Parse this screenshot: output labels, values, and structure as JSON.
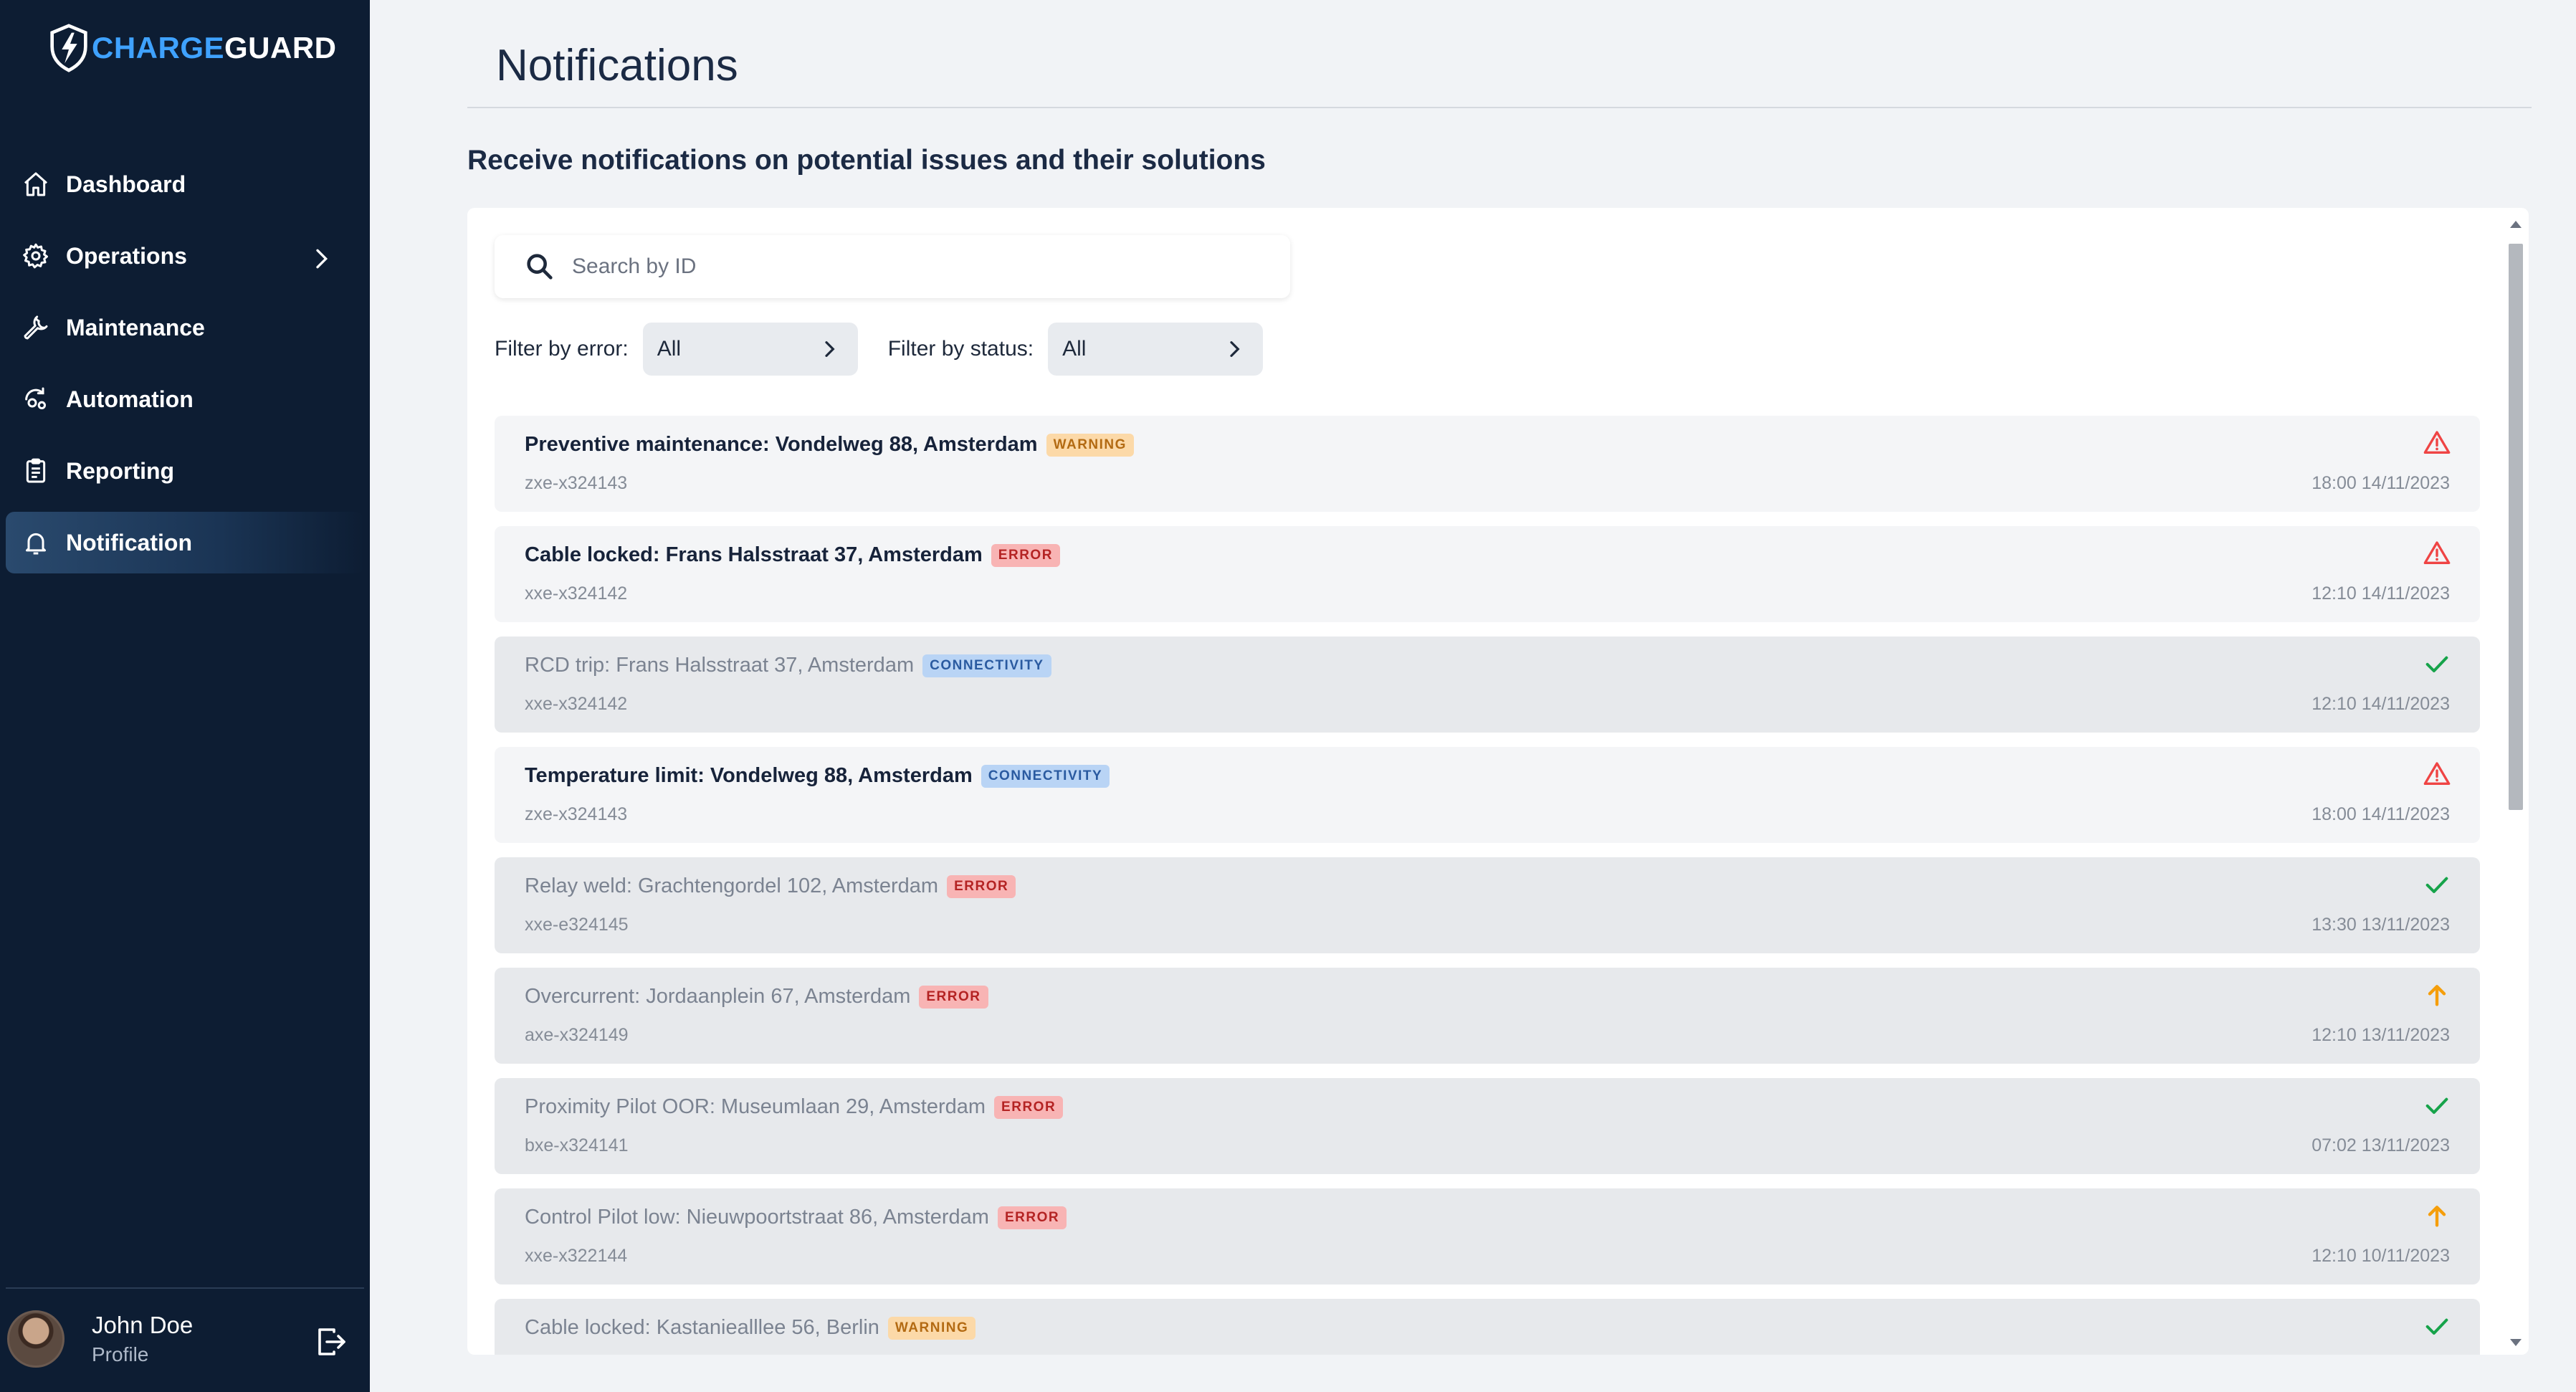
{
  "brand": {
    "part1": "CHARGE",
    "part2": "GUARD",
    "accent": "#3fa2ff"
  },
  "sidebar": {
    "items": [
      {
        "label": "Dashboard",
        "icon": "home-icon",
        "active": false
      },
      {
        "label": "Operations",
        "icon": "gear-icon",
        "active": false,
        "has_submenu": true
      },
      {
        "label": "Maintenance",
        "icon": "wrench-icon",
        "active": false
      },
      {
        "label": "Automation",
        "icon": "automation-icon",
        "active": false
      },
      {
        "label": "Reporting",
        "icon": "clipboard-icon",
        "active": false
      },
      {
        "label": "Notification",
        "icon": "bell-icon",
        "active": true
      }
    ],
    "user": {
      "name": "John Doe",
      "subtitle": "Profile"
    }
  },
  "page": {
    "title": "Notifications",
    "subtitle": "Receive notifications on potential issues and their solutions"
  },
  "search": {
    "placeholder": "Search by ID",
    "value": ""
  },
  "filters": {
    "error_label": "Filter by error:",
    "error_value": "All",
    "status_label": "Filter by status:",
    "status_value": "All"
  },
  "badge_colors": {
    "WARNING": {
      "bg": "#fcd9a8",
      "fg": "#b36a12"
    },
    "ERROR": {
      "bg": "#f8b4b4",
      "fg": "#b42323"
    },
    "CONNECTIVITY": {
      "bg": "#b9d4f5",
      "fg": "#2a5aa0"
    }
  },
  "status_icon_colors": {
    "warning-triangle-icon": "#ef4444",
    "checkmark-icon": "#16a34a",
    "arrow-up-icon": "#f59e0b"
  },
  "notifications": [
    {
      "title": "Preventive maintenance: Vondelweg 88, Amsterdam",
      "badge": "WARNING",
      "id": "zxe-x324143",
      "time": "18:00 14/11/2023",
      "status_icon": "warning-triangle-icon",
      "read": false
    },
    {
      "title": "Cable locked: Frans Halsstraat 37, Amsterdam",
      "badge": "ERROR",
      "id": "xxe-x324142",
      "time": "12:10 14/11/2023",
      "status_icon": "warning-triangle-icon",
      "read": false
    },
    {
      "title": "RCD trip: Frans Halsstraat 37, Amsterdam",
      "badge": "CONNECTIVITY",
      "id": "xxe-x324142",
      "time": "12:10 14/11/2023",
      "status_icon": "checkmark-icon",
      "read": true
    },
    {
      "title": "Temperature limit: Vondelweg 88, Amsterdam",
      "badge": "CONNECTIVITY",
      "id": "zxe-x324143",
      "time": "18:00 14/11/2023",
      "status_icon": "warning-triangle-icon",
      "read": false
    },
    {
      "title": "Relay weld: Grachtengordel 102, Amsterdam",
      "badge": "ERROR",
      "id": "xxe-e324145",
      "time": "13:30 13/11/2023",
      "status_icon": "checkmark-icon",
      "read": true
    },
    {
      "title": "Overcurrent: Jordaanplein 67, Amsterdam",
      "badge": "ERROR",
      "id": "axe-x324149",
      "time": "12:10 13/11/2023",
      "status_icon": "arrow-up-icon",
      "read": true
    },
    {
      "title": "Proximity Pilot OOR: Museumlaan 29, Amsterdam",
      "badge": "ERROR",
      "id": "bxe-x324141",
      "time": "07:02 13/11/2023",
      "status_icon": "checkmark-icon",
      "read": true
    },
    {
      "title": "Control Pilot low: Nieuwpoortstraat 86, Amsterdam",
      "badge": "ERROR",
      "id": "xxe-x322144",
      "time": "12:10 10/11/2023",
      "status_icon": "arrow-up-icon",
      "read": true
    },
    {
      "title": "Cable locked: Kastaniealllee 56, Berlin",
      "badge": "WARNING",
      "id": "",
      "time": "",
      "status_icon": "checkmark-icon",
      "read": true
    }
  ]
}
